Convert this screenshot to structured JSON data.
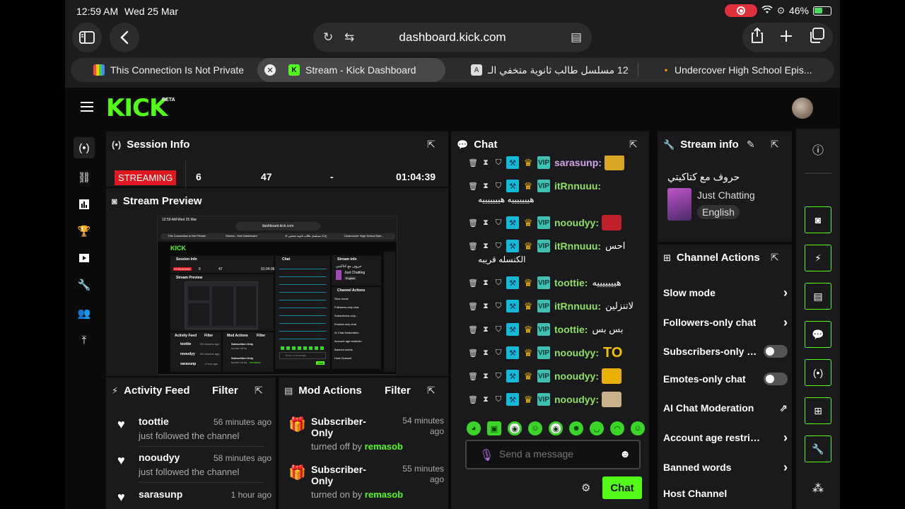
{
  "status_bar": {
    "time": "12:59 AM",
    "date": "Wed 25 Mar",
    "battery": "46%"
  },
  "browser": {
    "url": "dashboard.kick.com",
    "tabs": [
      {
        "label": "This Connection Is Not Private"
      },
      {
        "label": "Stream - Kick Dashboard"
      },
      {
        "label": "ح12 مسلسل طالب ثانوية متخفي الـ"
      },
      {
        "label": "Undercover High School Epis..."
      }
    ]
  },
  "app": {
    "logo": "KICK",
    "beta": "BETA"
  },
  "session_info": {
    "title": "Session Info",
    "status": "STREAMING",
    "viewers": "6",
    "followers": "47",
    "subs": "-",
    "duration": "01:04:39"
  },
  "stream_preview": {
    "title": "Stream Preview",
    "mini": {
      "time": "12:59 AM",
      "date": "Wed 25 Mar",
      "url": "dashboard.kick.com",
      "tab1": "This Connection is Not Private",
      "tab2": "Stream - Kick Dashboard",
      "tab3": "ح12 مسلسل طالب ثانوية متخفي الـ",
      "tab4": "Undercover High School Epis...",
      "logo": "KICK",
      "session": "Session Info",
      "streaming": "STREAMING",
      "v": "6",
      "f": "47",
      "dur": "01:04:36",
      "preview": "Stream Preview",
      "chat": "Chat",
      "stream_info": "Stream info",
      "si_title": "حروف مع كتاكيتي",
      "cat": "Just Chatting",
      "lang": "English",
      "channel_actions": "Channel Actions",
      "actions": [
        "Slow mode",
        "Followers-only chat",
        "Subscribers-only...",
        "Emotes-only chat",
        "AI Chat Moderation",
        "Account age restrictio",
        "Banned words",
        "Host Channel"
      ],
      "activity": "Activity Feed",
      "mod": "Mod Actions",
      "filter": "Filter",
      "feed": [
        [
          "toottie",
          "56 minutes ago"
        ],
        [
          "nooudyy",
          "58 minutes ago"
        ],
        [
          "sarasunp",
          "1 hour ago"
        ]
      ],
      "sub_only": "Subscriber-Only",
      "turned_off": "turned off by",
      "turned_on": "turned on by",
      "remasob": "remasob",
      "send": "Send a message",
      "chat_btn": "Chat"
    }
  },
  "activity_feed": {
    "title": "Activity Feed",
    "filter": "Filter",
    "items": [
      {
        "user": "toottie",
        "action": "just followed the channel",
        "time": "56 minutes ago"
      },
      {
        "user": "nooudyy",
        "action": "just followed the channel",
        "time": "58 minutes ago"
      },
      {
        "user": "sarasunp",
        "action": "",
        "time": "1 hour ago"
      }
    ]
  },
  "mod_actions": {
    "title": "Mod Actions",
    "filter": "Filter",
    "items": [
      {
        "action": "Subscriber-Only",
        "detail": "turned off by",
        "by": "remasob",
        "time": "54 minutes ago"
      },
      {
        "action": "Subscriber-Only",
        "detail": "turned on by",
        "by": "remasob",
        "time": "55 minutes ago"
      }
    ]
  },
  "chat": {
    "title": "Chat",
    "messages": [
      {
        "user": "sarasunp:",
        "text": ""
      },
      {
        "user": "itRnnuuu:",
        "text": "",
        "wrap": "هيييييييه هيييييييه"
      },
      {
        "user": "nooudyy:",
        "text": ""
      },
      {
        "user": "itRnnuuu:",
        "text": "احس",
        "wrap": "الكنسله قريبه"
      },
      {
        "user": "toottie:",
        "text": "هيييييييه"
      },
      {
        "user": "itRnnuuu:",
        "text": "لاتنزلين"
      },
      {
        "user": "toottie:",
        "text": "بس بس"
      },
      {
        "user": "nooudyy:",
        "text": "TO"
      },
      {
        "user": "nooudyy:",
        "text": ""
      },
      {
        "user": "nooudyy:",
        "text": ""
      }
    ],
    "badge_vip": "VIP",
    "input_placeholder": "Send a message",
    "send_label": "Chat"
  },
  "stream_info": {
    "title": "Stream info",
    "stream_title": "حروف مع كتاكيتي",
    "category": "Just Chatting",
    "language": "English"
  },
  "channel_actions": {
    "title": "Channel Actions",
    "items": [
      {
        "label": "Slow mode",
        "control": "chevron"
      },
      {
        "label": "Followers-only chat",
        "control": "chevron"
      },
      {
        "label": "Subscribers-only chat",
        "control": "toggle"
      },
      {
        "label": "Emotes-only chat",
        "control": "toggle"
      },
      {
        "label": "AI Chat Moderation",
        "control": "external"
      },
      {
        "label": "Account age restriction",
        "control": "chevron"
      },
      {
        "label": "Banned words",
        "control": "chevron"
      },
      {
        "label": "Host Channel",
        "control": "none"
      }
    ]
  },
  "colors": {
    "brand": "#53fc18",
    "live": "#e0181f",
    "panel": "#1a1a1c",
    "bg": "#0b0b0c"
  }
}
